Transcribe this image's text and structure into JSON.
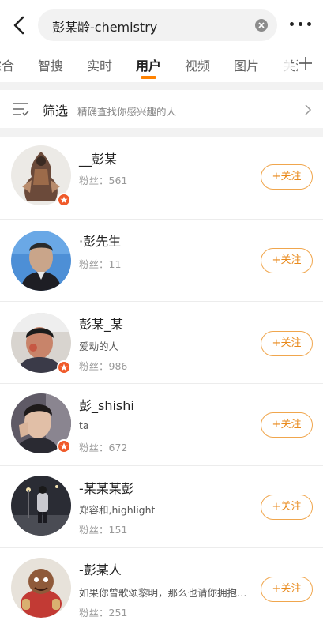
{
  "search": {
    "query": "彭某龄-chemistry"
  },
  "tabs": [
    {
      "label": "综合"
    },
    {
      "label": "智搜"
    },
    {
      "label": "实时"
    },
    {
      "label": "用户"
    },
    {
      "label": "视频"
    },
    {
      "label": "图片"
    },
    {
      "label": "关注"
    }
  ],
  "active_tab": "用户",
  "filter": {
    "title": "筛选",
    "description": "精确查找你感兴趣的人"
  },
  "follow_label": "+关注",
  "users": [
    {
      "name": "__彭某",
      "description": "",
      "fans": "粉丝：561",
      "verified": true
    },
    {
      "name": "·彭先生",
      "description": "",
      "fans": "粉丝：11",
      "verified": false
    },
    {
      "name": "彭某_某",
      "description": "爱动的人",
      "fans": "粉丝：986",
      "verified": true
    },
    {
      "name": "彭_shishi",
      "description": "ta",
      "fans": "粉丝：672",
      "verified": true
    },
    {
      "name": "-某某某彭",
      "description": "郑容和,highlight",
      "fans": "粉丝：151",
      "verified": false
    },
    {
      "name": "-彭某人",
      "description": "如果你曾歌颂黎明，那么也请你拥抱黑夜",
      "fans": "粉丝：251",
      "verified": false
    }
  ],
  "colors": {
    "accent": "#ff8200",
    "follow_border": "#f0a64d",
    "verified_badge": "#f05a2a"
  }
}
